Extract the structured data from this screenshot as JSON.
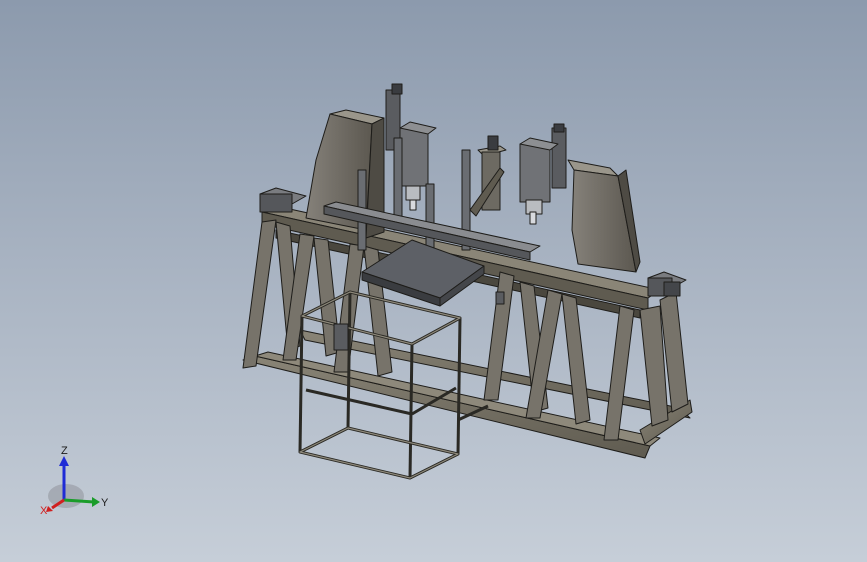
{
  "scene": {
    "background_top": "#8c9aad",
    "background_bottom": "#c6ced8",
    "frame_color": "#6f6b5f",
    "frame_dark": "#4a473e",
    "frame_light": "#8e897b",
    "table_top_color": "#5d6066",
    "motor_color": "#5a5c60",
    "edge_color": "#1e1d1a"
  },
  "triad": {
    "z_label": "Z",
    "y_label": "Y",
    "x_label": "X",
    "z_color": "#1f2bd6",
    "y_color": "#1a9c2a",
    "x_color": "#d02020"
  }
}
